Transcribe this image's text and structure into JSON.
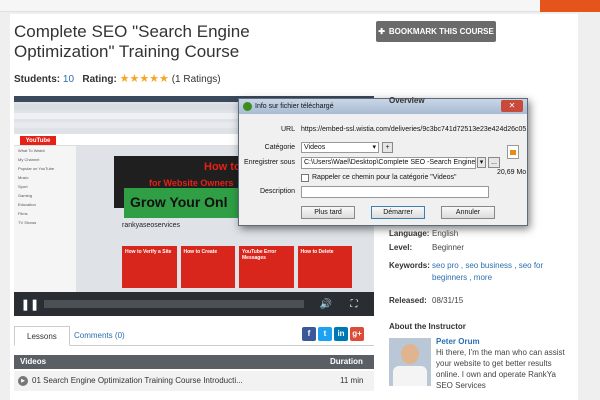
{
  "page": {
    "title": "Complete SEO \"Search Engine Optimization\" Training Course",
    "students_label": "Students:",
    "students_value": "10",
    "rating_label": "Rating:",
    "rating_stars": "★★★★★",
    "rating_count": "(1 Ratings)",
    "bookmark_button": "BOOKMARK THIS COURSE"
  },
  "video": {
    "yt_logo": "YouTube",
    "channel_name": "rankyaseoservices",
    "banner_line1": "How to",
    "banner_line2": "for Website Owners",
    "banner_line3": "Grow Your Onl",
    "side_items": [
      "What To Watch",
      "My Channel",
      "Popular on YouTube",
      "Music",
      "Sport",
      "Gaming",
      "Education",
      "Films",
      "TV Shows"
    ],
    "thumb_labels": [
      "How to Verify a Site",
      "How to Create",
      "YouTube Error Messages",
      "How to Delete"
    ]
  },
  "dialog": {
    "title": "Info sur fichier téléchargé",
    "close": "✕",
    "url_label": "URL",
    "url_value": "https://embed-ssl.wistia.com/deliveries/9c3bc741d72513e23e424d26c05",
    "category_label": "Catégorie",
    "category_value": "Videos",
    "save_label": "Enregistrer sous",
    "save_value": "C:\\Users\\Wael\\Desktop\\Complete SEO -Search Engine Optimizati",
    "browse_button": "...",
    "plus_button": "+",
    "remember_label": "Rappeler ce chemin pour la catégorie \"Videos\"",
    "description_label": "Description",
    "file_size": "20,69  Mo",
    "later_button": "Plus tard",
    "start_button": "Démarrer",
    "cancel_button": "Annuler"
  },
  "sidebar": {
    "overview_heading": "Overview",
    "rows": [
      {
        "key": "Language:",
        "value": "English"
      },
      {
        "key": "Level:",
        "value": "Beginner"
      },
      {
        "key": "Keywords:",
        "value": "seo pro , seo business , seo for beginners , more"
      },
      {
        "key": "Released:",
        "value": "08/31/15"
      }
    ],
    "about_heading": "About the Instructor",
    "instructor_name": "Peter Orum",
    "instructor_bio": "Hi there, I'm the man who can assist your website to get better results online. I own and operate RankYa SEO Services"
  },
  "tabs": {
    "lessons": "Lessons",
    "comments": "Comments (0)"
  },
  "share": {
    "facebook": "f",
    "twitter": "t",
    "linkedin": "in",
    "googleplus": "g+"
  },
  "lessons_list": {
    "col_videos": "Videos",
    "col_duration": "Duration",
    "rows": [
      {
        "title": "01 Search Engine Optimization Training Course Introducti...",
        "duration": "11 min"
      }
    ]
  },
  "colors": {
    "accent_orange": "#e5541a",
    "link_blue": "#2a6fb0",
    "star_gold": "#f5a623"
  }
}
